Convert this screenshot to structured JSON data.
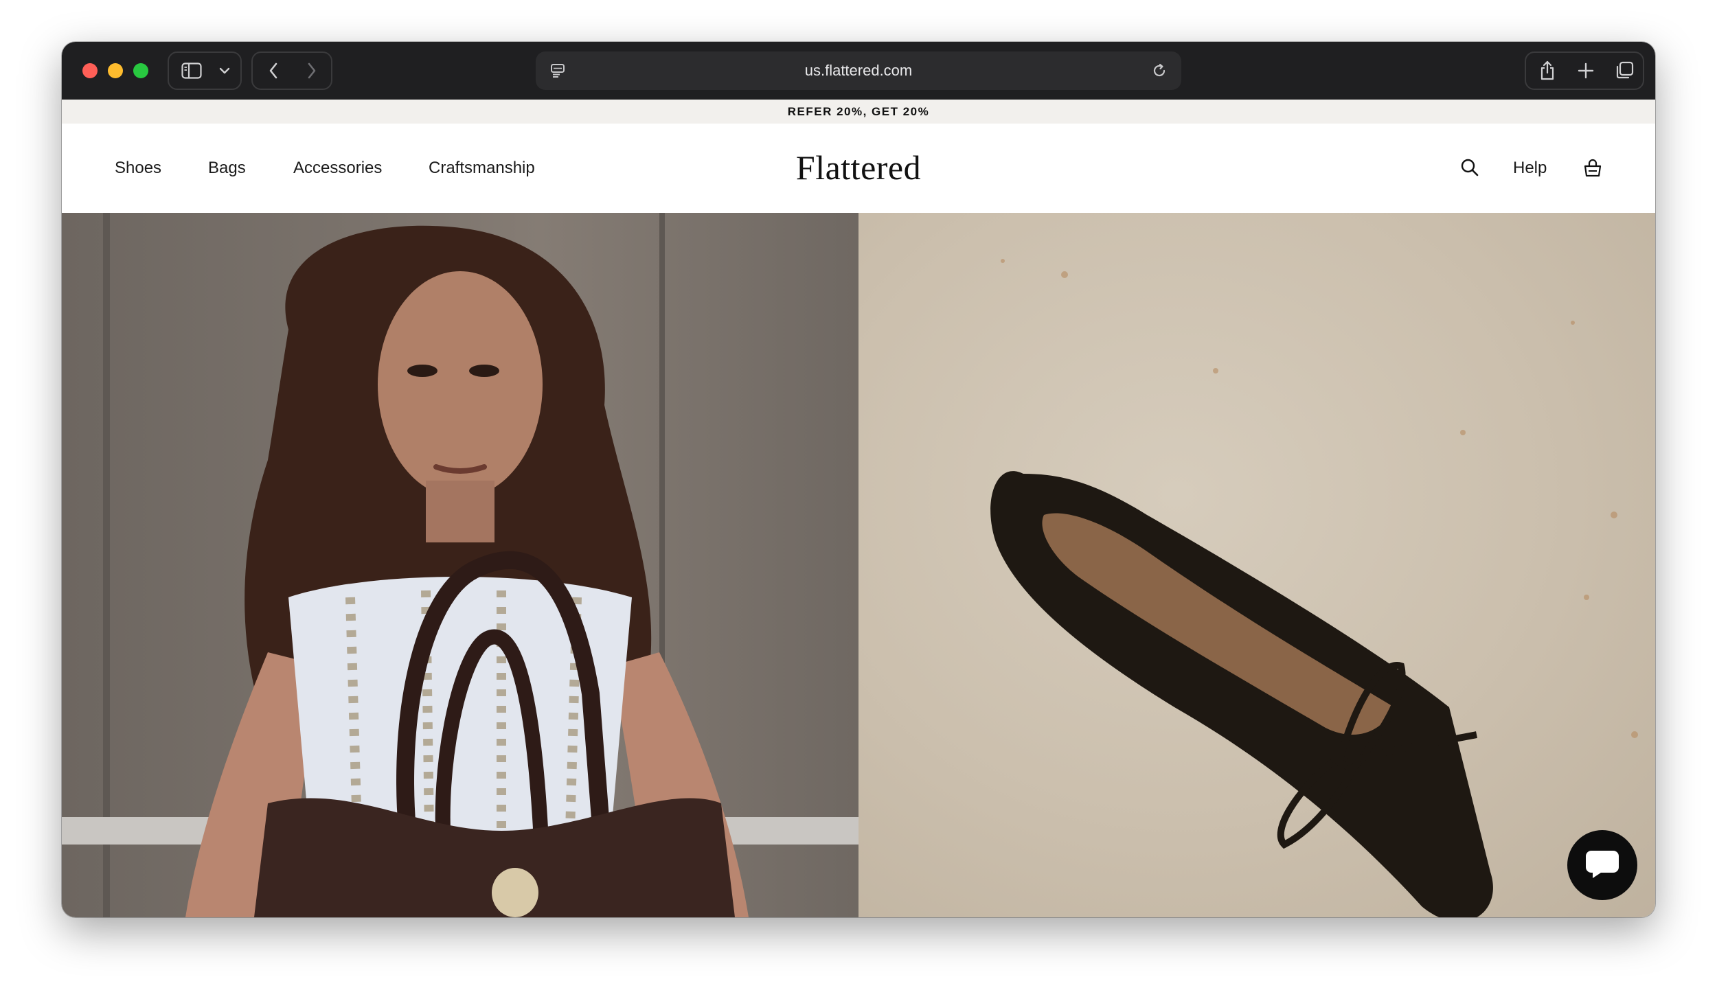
{
  "browser": {
    "url": "us.flattered.com",
    "icons": {
      "sidebar": "sidebar-icon",
      "dropdown": "chevron-down-icon",
      "back": "chevron-left-icon",
      "forward": "chevron-right-icon",
      "page_menu": "page-menu-icon",
      "reload": "reload-icon",
      "share": "share-icon",
      "new_tab": "plus-icon",
      "tabs": "tabs-icon"
    }
  },
  "announcement": {
    "text": "REFER 20%, GET 20%"
  },
  "header": {
    "nav": [
      "Shoes",
      "Bags",
      "Accessories",
      "Craftsmanship"
    ],
    "logo": "Flattered",
    "help": "Help",
    "icons": {
      "search": "search-icon",
      "cart": "shopping-bag-icon"
    }
  },
  "hero": {
    "left_image": "model-with-handbag-photo",
    "right_image": "black-ballet-flat-photo"
  },
  "chat": {
    "icon": "chat-bubble-icon"
  },
  "colors": {
    "toolbar": "#1f1f21",
    "announcement_bg": "#f2f0ed",
    "text": "#111111",
    "chat_button": "#0d0d0d"
  }
}
